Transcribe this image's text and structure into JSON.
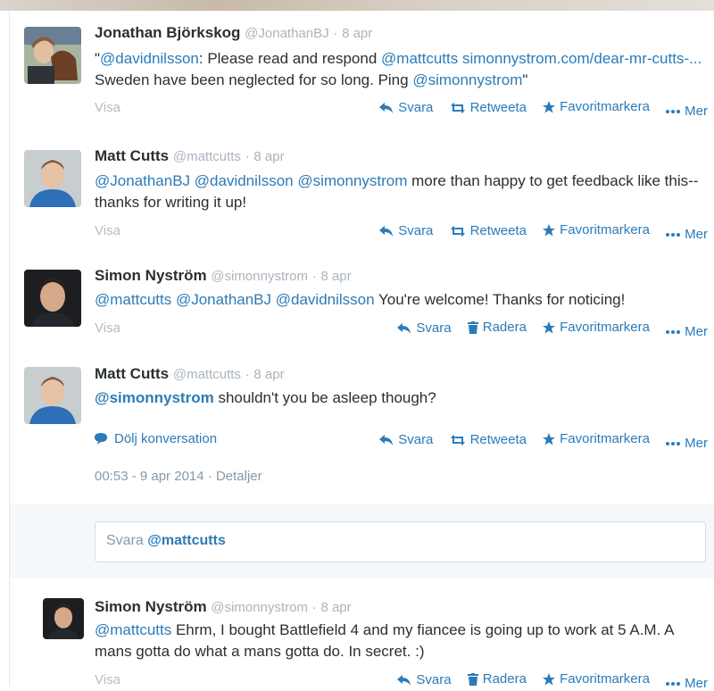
{
  "tweets": [
    {
      "name": "Jonathan Björkskog",
      "handle": "@JonathanBJ",
      "date": "8 apr",
      "text_1": "\"",
      "mention_1": "@davidnilsson",
      "text_2": ": Please read and respond ",
      "mention_2": "@mattcutts",
      "link": "simonnystrom.com/dear-mr-cutts-...",
      "text_3": " Sweden have been neglected for so long. Ping ",
      "mention_3": "@simonnystrom",
      "text_4": "\"",
      "visa": "Visa",
      "actions": {
        "reply": "Svara",
        "retweet": "Retweeta",
        "favorite": "Favoritmarkera",
        "more": "Mer"
      }
    },
    {
      "name": "Matt Cutts",
      "handle": "@mattcutts",
      "date": "8 apr",
      "mention_1": "@JonathanBJ",
      "mention_2": "@davidnilsson",
      "mention_3": "@simonnystrom",
      "text": " more than happy to get feedback like this--thanks for writing it up!",
      "visa": "Visa",
      "actions": {
        "reply": "Svara",
        "retweet": "Retweeta",
        "favorite": "Favoritmarkera",
        "more": "Mer"
      }
    },
    {
      "name": "Simon Nyström",
      "handle": "@simonnystrom",
      "date": "8 apr",
      "mention_1": "@mattcutts",
      "mention_2": "@JonathanBJ",
      "mention_3": "@davidnilsson",
      "text": " You're welcome! Thanks for noticing!",
      "visa": "Visa",
      "actions": {
        "reply": "Svara",
        "delete": "Radera",
        "favorite": "Favoritmarkera",
        "more": "Mer"
      }
    },
    {
      "name": "Matt Cutts",
      "handle": "@mattcutts",
      "date": "8 apr",
      "mention_1": "@simonnystrom",
      "text": " shouldn't you be asleep though?",
      "hide_conversation": "Dölj konversation",
      "actions": {
        "reply": "Svara",
        "retweet": "Retweeta",
        "favorite": "Favoritmarkera",
        "more": "Mer"
      },
      "timestamp": "00:53 - 9 apr 2014",
      "details": "Detaljer"
    },
    {
      "name": "Simon Nyström",
      "handle": "@simonnystrom",
      "date": "8 apr",
      "mention_1": "@mattcutts",
      "text": " Ehrm, I bought Battlefield 4 and my fiancee is going up to work at 5 A.M. A mans gotta do what a mans gotta do. In secret. :)",
      "visa": "Visa",
      "actions": {
        "reply": "Svara",
        "delete": "Radera",
        "favorite": "Favoritmarkera",
        "more": "Mer"
      }
    }
  ],
  "reply_box": {
    "prefix": "Svara ",
    "mention": "@mattcutts"
  },
  "separator": "·",
  "colors": {
    "link": "#2b7bb9",
    "muted": "#aab4bd",
    "border": "#e1e8ed"
  }
}
